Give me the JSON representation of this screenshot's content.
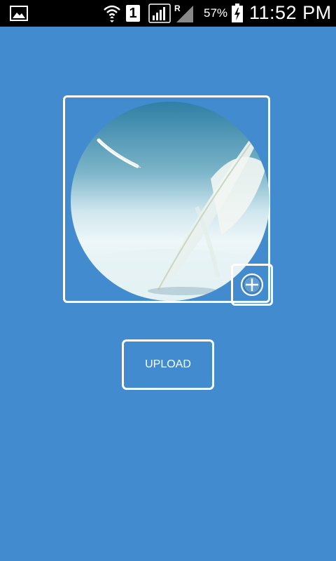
{
  "status_bar": {
    "notification_icon": "image-icon",
    "wifi_icon": "wifi-icon",
    "sim_label": "1",
    "signal_icon": "signal-icon",
    "roaming_label": "R",
    "battery_percent": "57%",
    "battery_level": 0.57,
    "battery_icon": "battery-charging-icon",
    "time": "11:52 PM"
  },
  "image_picker": {
    "photo_description_icon": "feather-photo",
    "add_icon": "plus-circle-icon"
  },
  "upload_button": {
    "label": "UPLOAD"
  },
  "colors": {
    "background": "#428bcf",
    "status_bar": "#000000",
    "border": "#ffffff"
  }
}
